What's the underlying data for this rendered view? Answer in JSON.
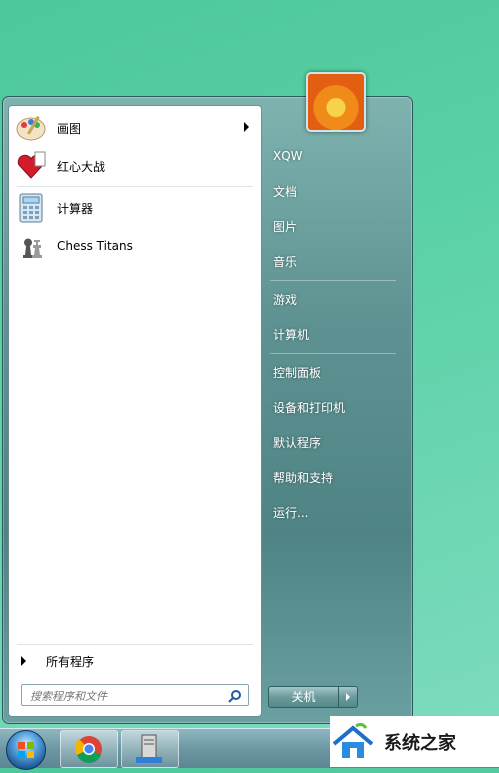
{
  "start_menu": {
    "programs": [
      {
        "label": "画图",
        "icon": "paint-icon",
        "has_submenu": true
      },
      {
        "label": "红心大战",
        "icon": "hearts-icon",
        "has_submenu": false
      },
      {
        "label": "计算器",
        "icon": "calculator-icon",
        "has_submenu": false
      },
      {
        "label": "Chess Titans",
        "icon": "chess-icon",
        "has_submenu": false
      }
    ],
    "all_programs": "所有程序",
    "search_placeholder": "搜索程序和文件",
    "right_items": [
      "XQW",
      "文档",
      "图片",
      "音乐",
      "游戏",
      "计算机",
      "控制面板",
      "设备和打印机",
      "默认程序",
      "帮助和支持",
      "运行..."
    ],
    "shutdown_label": "关机"
  },
  "taskbar": {
    "pinned": [
      "start-orb",
      "chrome-icon",
      "server-icon"
    ]
  },
  "watermark": {
    "text": "系统之家"
  },
  "colors": {
    "desktop": "#5bd1a6",
    "panel_right": "#5f9393",
    "accent_text": "#ffffff"
  }
}
